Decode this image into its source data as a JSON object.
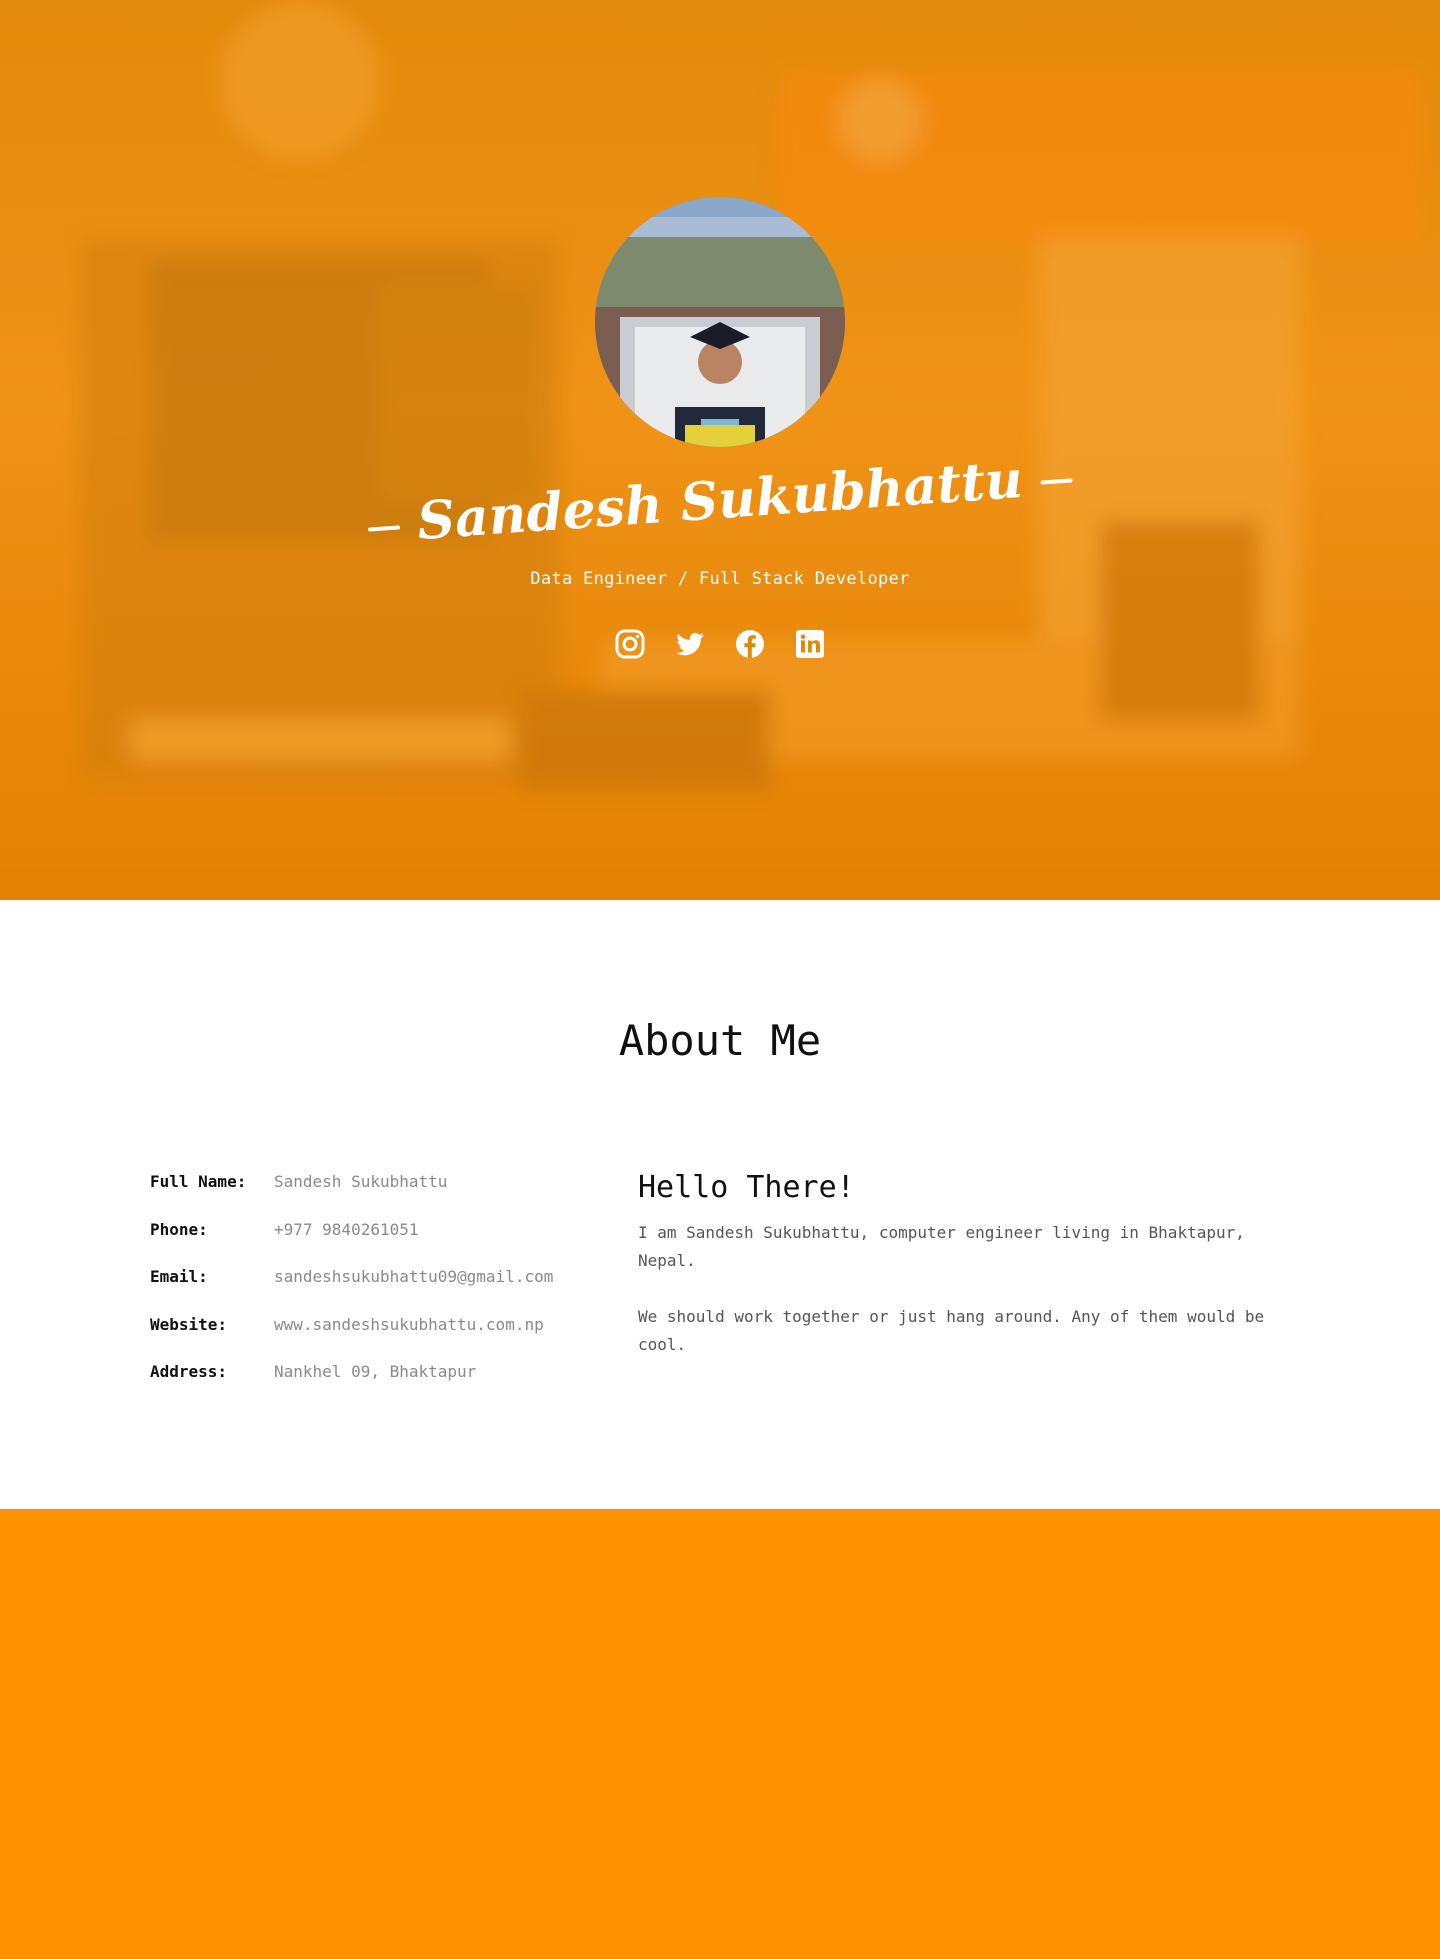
{
  "hero": {
    "name": "Sandesh Sukubhattu",
    "subtitle": "Data Engineer / Full Stack Developer",
    "socials": [
      {
        "icon": "instagram-icon"
      },
      {
        "icon": "twitter-icon"
      },
      {
        "icon": "facebook-icon"
      },
      {
        "icon": "linkedin-icon"
      }
    ]
  },
  "about": {
    "title": "About Me",
    "info": [
      {
        "label": "Full Name:",
        "value": "Sandesh Sukubhattu"
      },
      {
        "label": "Phone:",
        "value": "+977 9840261051"
      },
      {
        "label": "Email:",
        "value": "sandeshsukubhattu09@gmail.com"
      },
      {
        "label": "Website:",
        "value": "www.sandeshsukubhattu.com.np"
      },
      {
        "label": "Address:",
        "value": "Nankhel 09, Bhaktapur"
      }
    ],
    "hello_title": "Hello There!",
    "paragraphs": [
      "I am Sandesh Sukubhattu, computer engineer living in Bhaktapur, Nepal.",
      "We should work together or just hang around. Any of them would be cool."
    ]
  },
  "colors": {
    "accent": "#ff9000",
    "hero_tint": "#f0951a"
  }
}
